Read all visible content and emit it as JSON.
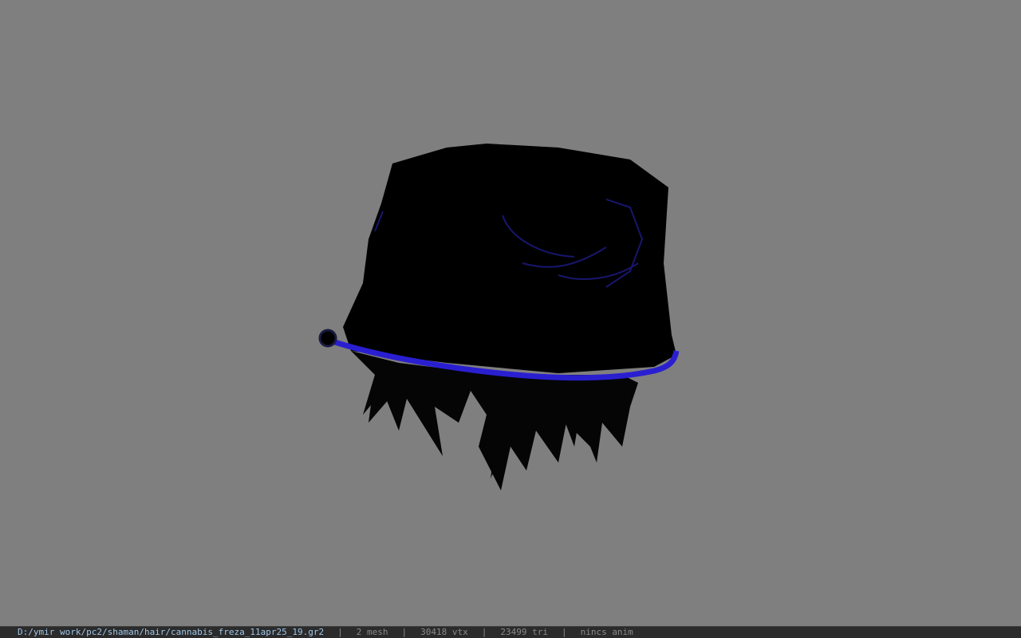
{
  "viewer": {
    "background_color": "#7f7f7f",
    "model": {
      "hat_color": "#000000",
      "band_color": "#2a1fd0",
      "hair_color": "#050505"
    }
  },
  "statusbar": {
    "file_path": "D:/ymir work/pc2/shaman/hair/cannabis_freza_11apr25_19.gr2",
    "separator": "|",
    "mesh": "2 mesh",
    "vtx": "30418 vtx",
    "tri": "23499 tri",
    "anim": "nincs anim"
  }
}
